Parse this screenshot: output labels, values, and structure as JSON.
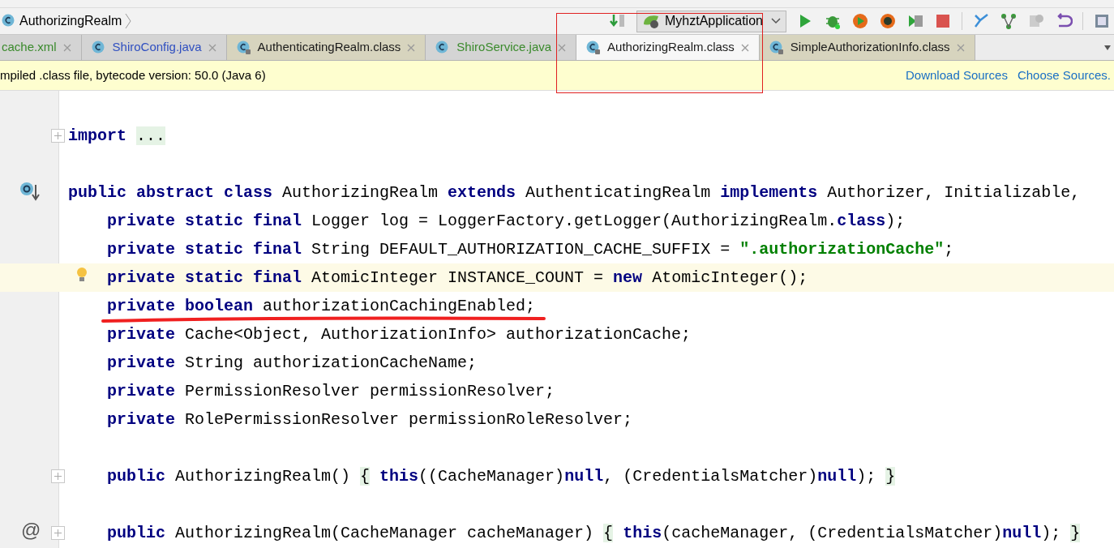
{
  "breadcrumb": {
    "label": "AuthorizingRealm"
  },
  "toolbar": {
    "run_config": "MyhztApplication"
  },
  "tabs": [
    {
      "label": "cache.xml",
      "color": "#3a8a2c",
      "locked": false,
      "selected": false,
      "icon": false
    },
    {
      "label": "ShiroConfig.java",
      "color": "#2f4fc0",
      "locked": false,
      "selected": false,
      "icon": true
    },
    {
      "label": "AuthenticatingRealm.class",
      "color": "#1a1a1a",
      "locked": true,
      "selected": false,
      "icon": true
    },
    {
      "label": "ShiroService.java",
      "color": "#3a8a2c",
      "locked": false,
      "selected": false,
      "icon": true
    },
    {
      "label": "AuthorizingRealm.class",
      "color": "#1a1a1a",
      "locked": true,
      "selected": true,
      "icon": true
    },
    {
      "label": "SimpleAuthorizationInfo.class",
      "color": "#1a1a1a",
      "locked": true,
      "selected": false,
      "icon": true
    }
  ],
  "banner": {
    "text": "mpiled .class file, bytecode version: 50.0 (Java 6)",
    "links": [
      "Download Sources",
      "Choose Sources."
    ]
  },
  "lines": [
    {
      "kind": "blank"
    },
    {
      "kind": "code",
      "fold": true,
      "tokens": [
        {
          "kind": "kw",
          "text": "import "
        },
        {
          "kind": "folded",
          "text": "..."
        }
      ]
    },
    {
      "kind": "blank"
    },
    {
      "kind": "code",
      "override_marker": true,
      "tokens": [
        {
          "kind": "kw",
          "text": "public abstract class"
        },
        {
          "kind": "plain",
          "text": " AuthorizingRealm "
        },
        {
          "kind": "kw",
          "text": "extends"
        },
        {
          "kind": "plain",
          "text": " AuthenticatingRealm "
        },
        {
          "kind": "kw",
          "text": "implements"
        },
        {
          "kind": "plain",
          "text": " Authorizer, Initializable,"
        }
      ],
      "children": [
        {
          "kind": "code",
          "tokens": [
            {
              "kind": "kw",
              "text": "private static final"
            },
            {
              "kind": "plain",
              "text": " Logger log = LoggerFactory.getLogger(AuthorizingRealm."
            },
            {
              "kind": "kw",
              "text": "class"
            },
            {
              "kind": "plain",
              "text": ");"
            }
          ]
        },
        {
          "kind": "code",
          "tokens": [
            {
              "kind": "kw",
              "text": "private static final"
            },
            {
              "kind": "plain",
              "text": " String DEFAULT_AUTHORIZATION_CACHE_SUFFIX = "
            },
            {
              "kind": "str",
              "text": "″.authorizationCache″"
            },
            {
              "kind": "plain",
              "text": ";"
            }
          ]
        },
        {
          "kind": "code",
          "highlighted": true,
          "bulb": true,
          "tokens": [
            {
              "kind": "kw",
              "text": "private static final"
            },
            {
              "kind": "plain",
              "text": " AtomicInteger INSTANCE_COUNT = "
            },
            {
              "kind": "kw",
              "text": "new"
            },
            {
              "kind": "plain",
              "text": " AtomicInteger();"
            }
          ]
        },
        {
          "kind": "code",
          "underlined": true,
          "tokens": [
            {
              "kind": "kw",
              "text": "private boolean"
            },
            {
              "kind": "plain",
              "text": " authorizationCachingEnabled;"
            }
          ]
        },
        {
          "kind": "code",
          "tokens": [
            {
              "kind": "kw",
              "text": "private"
            },
            {
              "kind": "plain",
              "text": " Cache<Object, AuthorizationInfo> authorizationCache;"
            }
          ]
        },
        {
          "kind": "code",
          "tokens": [
            {
              "kind": "kw",
              "text": "private"
            },
            {
              "kind": "plain",
              "text": " String authorizationCacheName;"
            }
          ]
        },
        {
          "kind": "code",
          "tokens": [
            {
              "kind": "kw",
              "text": "private"
            },
            {
              "kind": "plain",
              "text": " PermissionResolver permissionResolver;"
            }
          ]
        },
        {
          "kind": "code",
          "tokens": [
            {
              "kind": "kw",
              "text": "private"
            },
            {
              "kind": "plain",
              "text": " RolePermissionResolver permissionRoleResolver;"
            }
          ]
        },
        {
          "kind": "blank"
        },
        {
          "kind": "code",
          "fold": true,
          "tokens": [
            {
              "kind": "kw",
              "text": "public"
            },
            {
              "kind": "plain",
              "text": " AuthorizingRealm() "
            },
            {
              "kind": "folded",
              "text": "{"
            },
            {
              "kind": "kw",
              "text": " this"
            },
            {
              "kind": "plain",
              "text": "((CacheManager)"
            },
            {
              "kind": "kw",
              "text": "null"
            },
            {
              "kind": "plain",
              "text": ", (CredentialsMatcher)"
            },
            {
              "kind": "kw",
              "text": "null"
            },
            {
              "kind": "plain",
              "text": "); "
            },
            {
              "kind": "folded",
              "text": "}"
            }
          ]
        },
        {
          "kind": "blank"
        },
        {
          "kind": "code",
          "fold": true,
          "marker": "@",
          "tokens": [
            {
              "kind": "kw",
              "text": "public"
            },
            {
              "kind": "plain",
              "text": " AuthorizingRealm(CacheManager cacheManager) "
            },
            {
              "kind": "folded",
              "text": "{"
            },
            {
              "kind": "kw",
              "text": " this"
            },
            {
              "kind": "plain",
              "text": "(cacheManager, (CredentialsMatcher)"
            },
            {
              "kind": "kw",
              "text": "null"
            },
            {
              "kind": "plain",
              "text": "); "
            },
            {
              "kind": "folded",
              "text": "}"
            }
          ]
        }
      ]
    }
  ]
}
